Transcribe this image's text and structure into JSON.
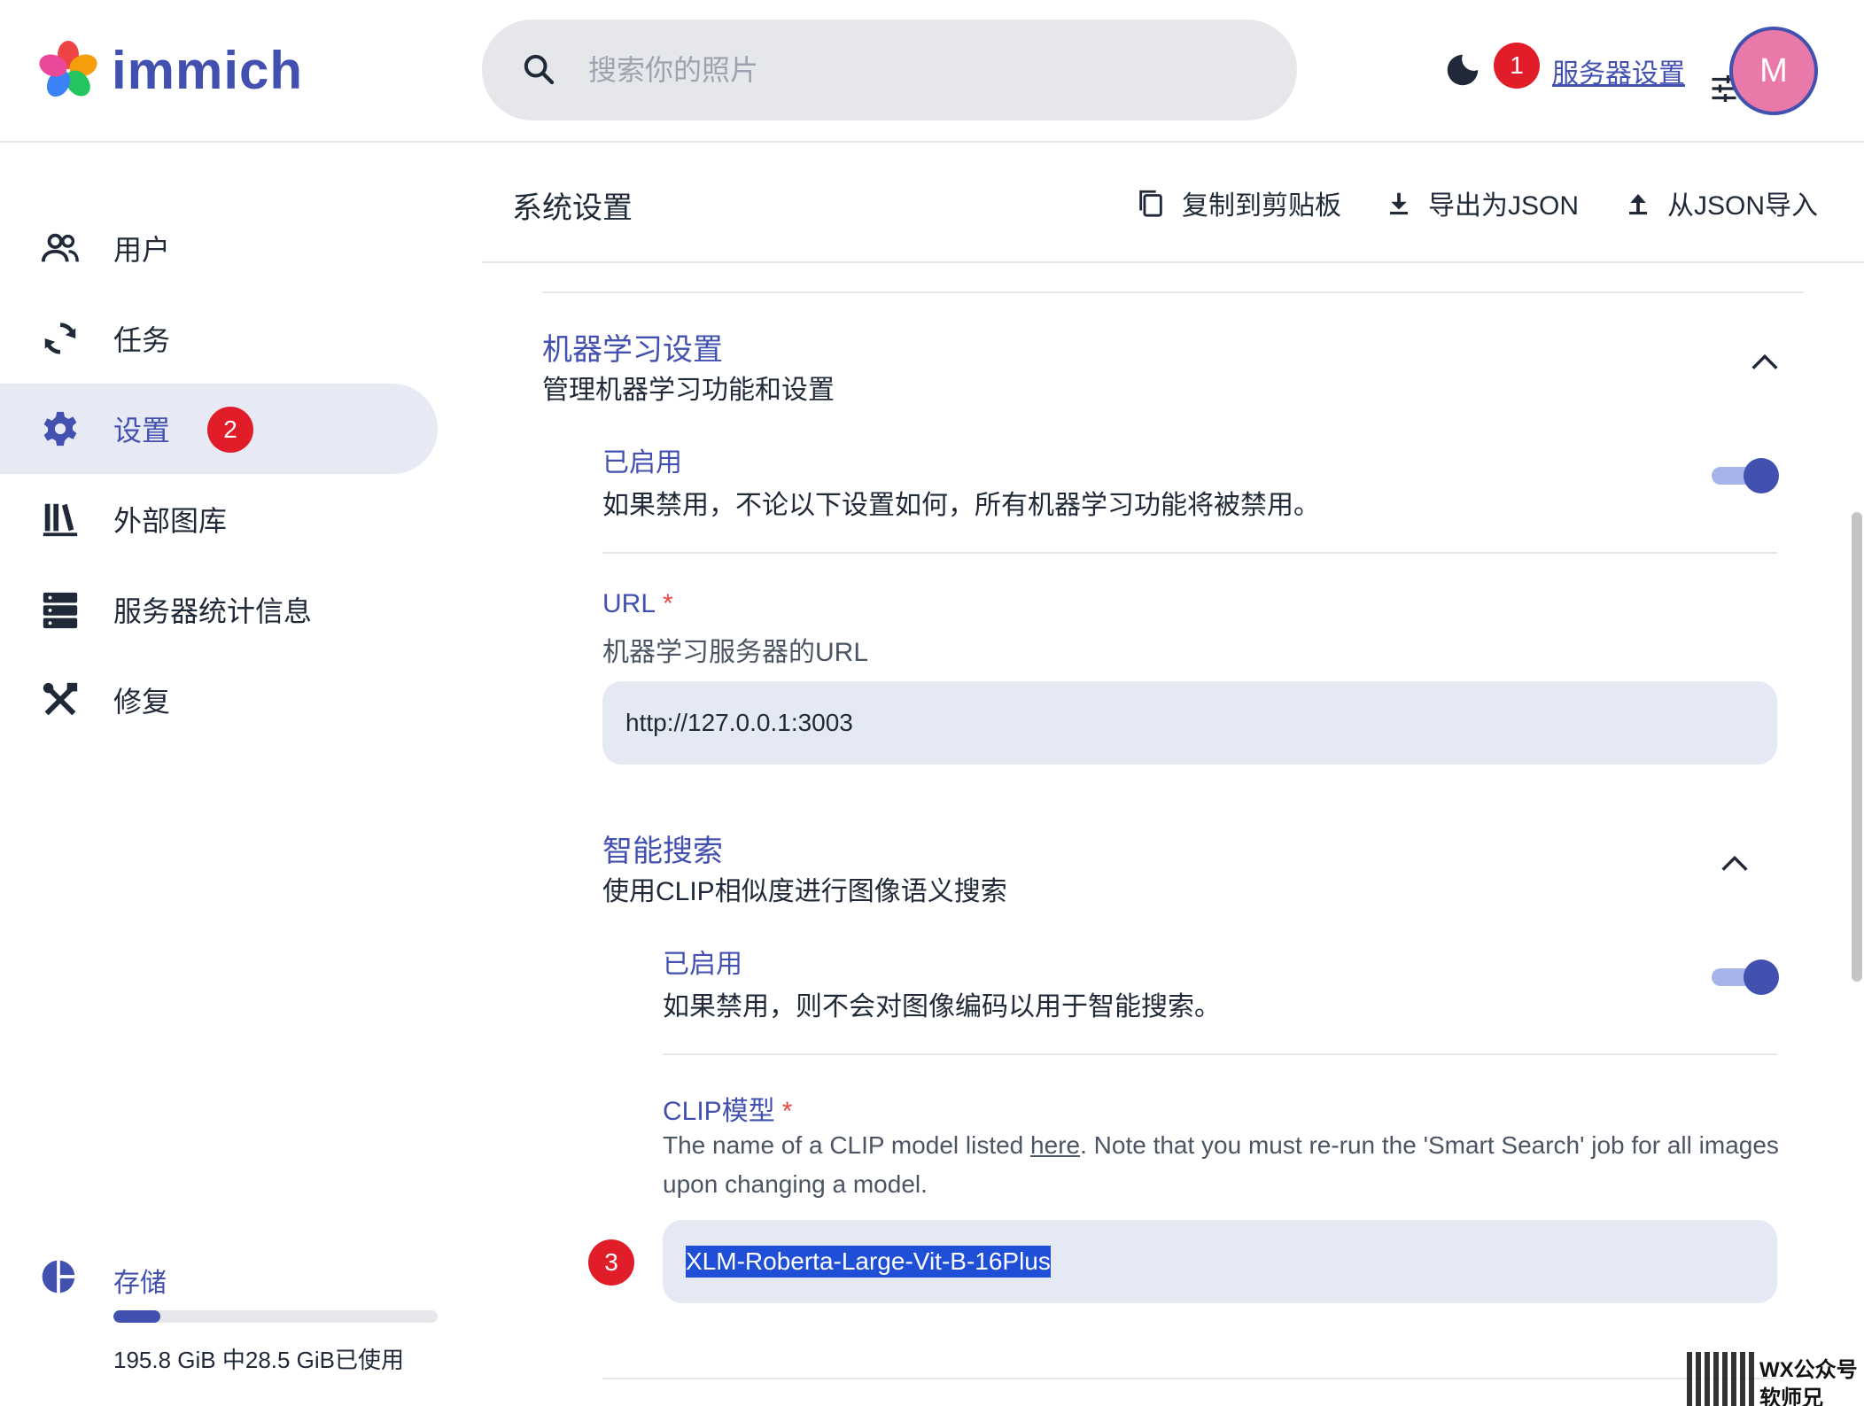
{
  "header": {
    "app_name": "immich",
    "search_placeholder": "搜索你的照片",
    "badge_1": "1",
    "server_settings_link": "服务器设置",
    "avatar_initial": "M"
  },
  "sidebar": {
    "items": [
      {
        "label": "用户",
        "icon": "users-icon"
      },
      {
        "label": "任务",
        "icon": "sync-icon"
      },
      {
        "label": "设置",
        "icon": "gear-icon",
        "badge": "2",
        "active": true
      },
      {
        "label": "外部图库",
        "icon": "library-icon"
      },
      {
        "label": "服务器统计信息",
        "icon": "server-icon"
      },
      {
        "label": "修复",
        "icon": "tools-icon"
      }
    ],
    "storage": {
      "label": "存储",
      "usage_text": "195.8 GiB 中28.5 GiB已使用",
      "used_fraction": 0.146
    }
  },
  "toolbar": {
    "title": "系统设置",
    "copy_label": "复制到剪贴板",
    "export_label": "导出为JSON",
    "import_label": "从JSON导入"
  },
  "ml": {
    "title": "机器学习设置",
    "desc": "管理机器学习功能和设置",
    "enabled_label": "已启用",
    "enabled_desc": "如果禁用，不论以下设置如何，所有机器学习功能将被禁用。",
    "enabled": true,
    "url_label": "URL",
    "required_mark": "*",
    "url_desc": "机器学习服务器的URL",
    "url_value": "http://127.0.0.1:3003"
  },
  "smart_search": {
    "title": "智能搜索",
    "desc": "使用CLIP相似度进行图像语义搜索",
    "enabled_label": "已启用",
    "enabled_desc": "如果禁用，则不会对图像编码以用于智能搜索。",
    "enabled": true,
    "clip_label": "CLIP模型",
    "clip_help_before": "The name of a CLIP model listed ",
    "clip_help_link": "here",
    "clip_help_after": ". Note that you must re-run the 'Smart Search' job for all images upon changing a model.",
    "clip_value": "XLM-Roberta-Large-Vit-B-16Plus",
    "badge_3": "3"
  },
  "watermark": {
    "line1": "WX公众号",
    "line2": "软师兄"
  },
  "colors": {
    "accent": "#4250af",
    "badge": "#e11d2a",
    "field_bg": "#e5e9f4",
    "avatar": "#e879a9"
  }
}
